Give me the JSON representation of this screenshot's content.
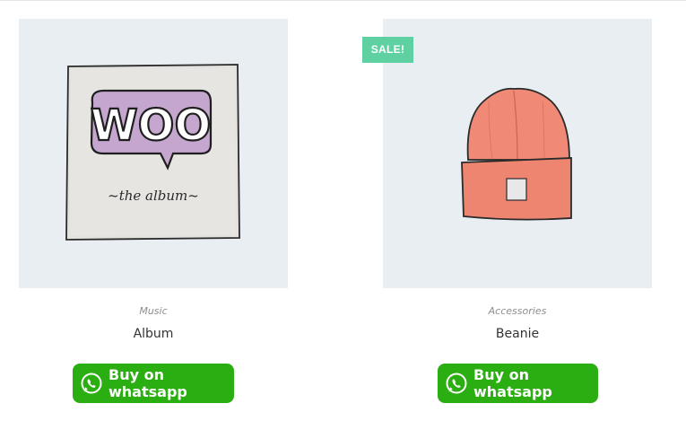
{
  "products": [
    {
      "image_name": "woo-album-cover",
      "badge": "",
      "category": "Music",
      "title": "Album",
      "button_label": "Buy on whatsapp",
      "art": {
        "logo_text": "WOO",
        "caption": "~the album~",
        "logo_color": "#c4a6ce"
      }
    },
    {
      "image_name": "beanie-hat",
      "badge": "SALE!",
      "category": "Accessories",
      "title": "Beanie",
      "button_label": "Buy on whatsapp",
      "art": {
        "hat_color": "#f08a76"
      }
    }
  ],
  "colors": {
    "whatsapp_green": "#2bae12",
    "sale_badge": "#5fd0a1",
    "image_bg": "#e9eef2"
  },
  "icons": {
    "button_icon": "whatsapp-icon"
  }
}
